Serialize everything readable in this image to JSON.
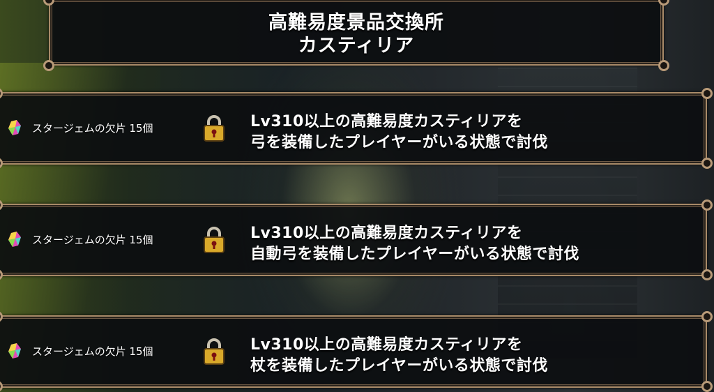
{
  "header": {
    "title_line1": "高難易度景品交換所",
    "title_line2": "カスティリア"
  },
  "rows": [
    {
      "reward_label": "スタージェムの欠片  15個",
      "condition_line1": "Lv310以上の高難易度カスティリアを",
      "condition_line2": "弓を装備したプレイヤーがいる状態で討伐",
      "reward_icon": "star-gem-fragment-icon",
      "status_icon": "padlock-icon"
    },
    {
      "reward_label": "スタージェムの欠片  15個",
      "condition_line1": "Lv310以上の高難易度カスティリアを",
      "condition_line2": "自動弓を装備したプレイヤーがいる状態で討伐",
      "reward_icon": "star-gem-fragment-icon",
      "status_icon": "padlock-icon"
    },
    {
      "reward_label": "スタージェムの欠片  15個",
      "condition_line1": "Lv310以上の高難易度カスティリアを",
      "condition_line2": "杖を装備したプレイヤーがいる状態で討伐",
      "reward_icon": "star-gem-fragment-icon",
      "status_icon": "padlock-icon"
    }
  ],
  "colors": {
    "frame_border": "#a88a68",
    "panel_bg": "#0c0e10",
    "text": "#ffffff",
    "lock_gold": "#d9a92a"
  }
}
